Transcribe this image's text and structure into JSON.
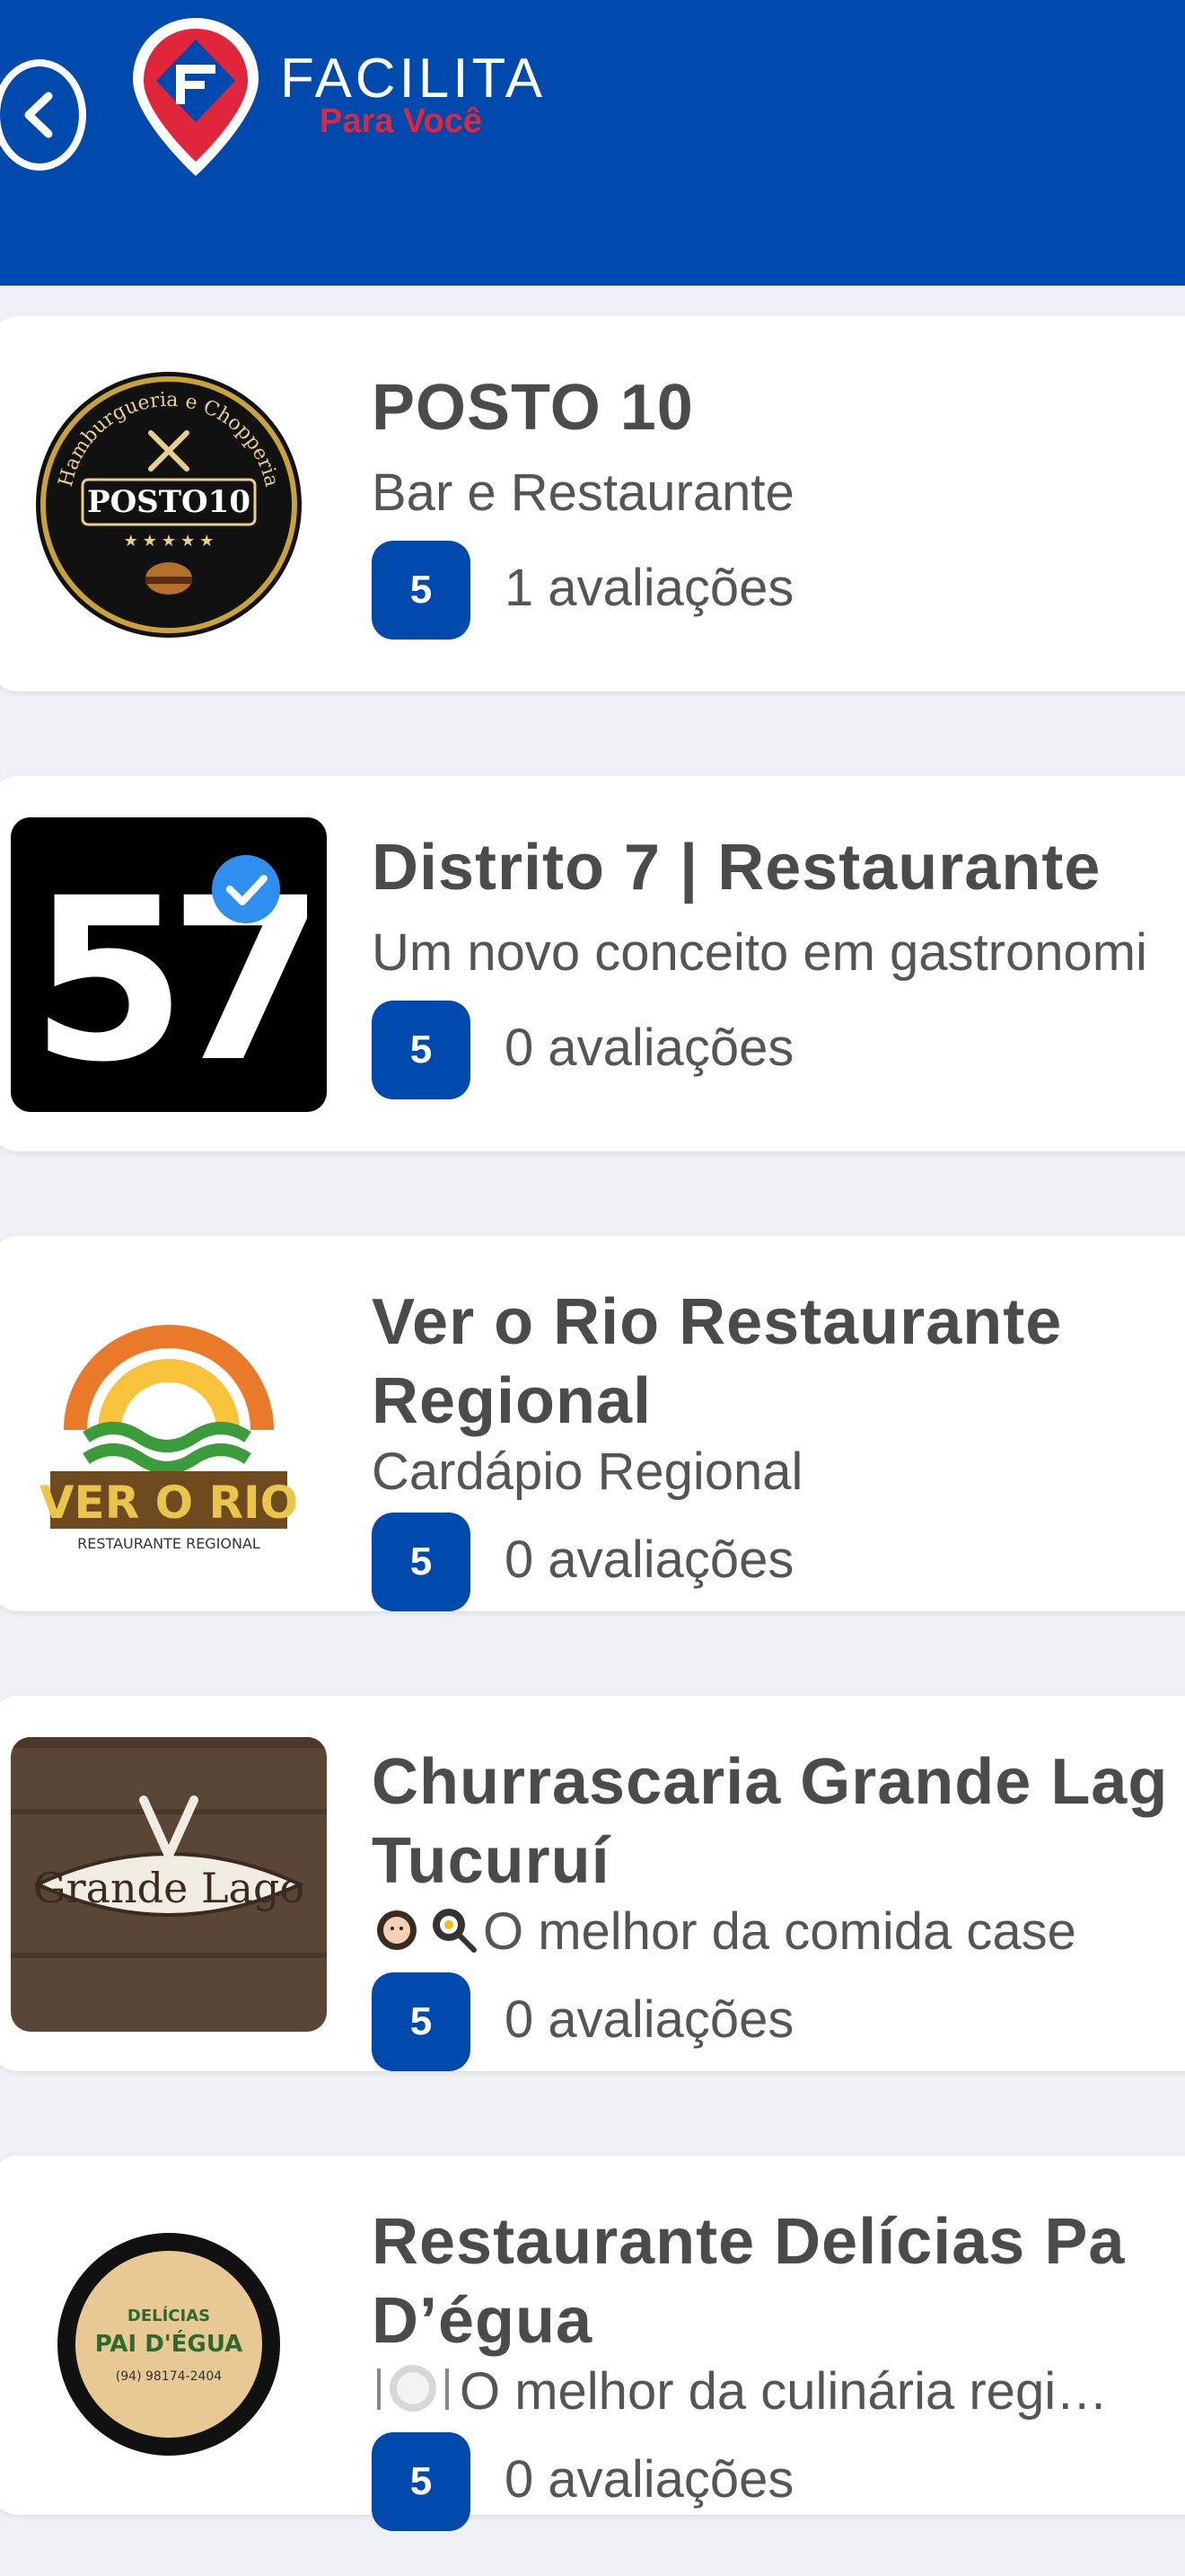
{
  "app": {
    "brand_name": "FACILITA",
    "brand_tagline": "Para Você",
    "colors": {
      "header": "#0049ad",
      "accent_red": "#e0263a",
      "badge": "#0049ad"
    }
  },
  "restaurants": [
    {
      "name": "POSTO  10",
      "description": "Bar e Restaurante",
      "rating": "5",
      "reviews": "1 avaliações",
      "logo": {
        "top_text": "Hamburgueria e Chopperia",
        "main_text": "POSTO10"
      }
    },
    {
      "name": "Distrito 7 | Restaurante",
      "description": "Um novo conceito em gastronomi",
      "rating": "5",
      "reviews": "0 avaliações",
      "logo": {
        "main_text": "57"
      }
    },
    {
      "name_line1": "Ver o Rio Restaurante",
      "name_line2": "Regional",
      "description": "Cardápio Regional",
      "rating": "5",
      "reviews": "0 avaliações",
      "logo": {
        "main_text": "VER O RIO",
        "sub_text": "RESTAURANTE REGIONAL"
      }
    },
    {
      "name_line1": "Churrascaria Grande Lag",
      "name_line2": "Tucuruí",
      "description": "O melhor da comida case",
      "rating": "5",
      "reviews": "0 avaliações",
      "logo": {
        "main_text": "Grande Lago"
      }
    },
    {
      "name_line1": "Restaurante Delícias Pa",
      "name_line2": "D’égua",
      "description": "O melhor da culinária regi…",
      "rating": "5",
      "reviews": "0 avaliações",
      "logo": {
        "main_text_1": "DELÍCIAS",
        "main_text_2": "PAI D'ÉGUA",
        "phone": "(94) 98174-2404"
      }
    }
  ]
}
